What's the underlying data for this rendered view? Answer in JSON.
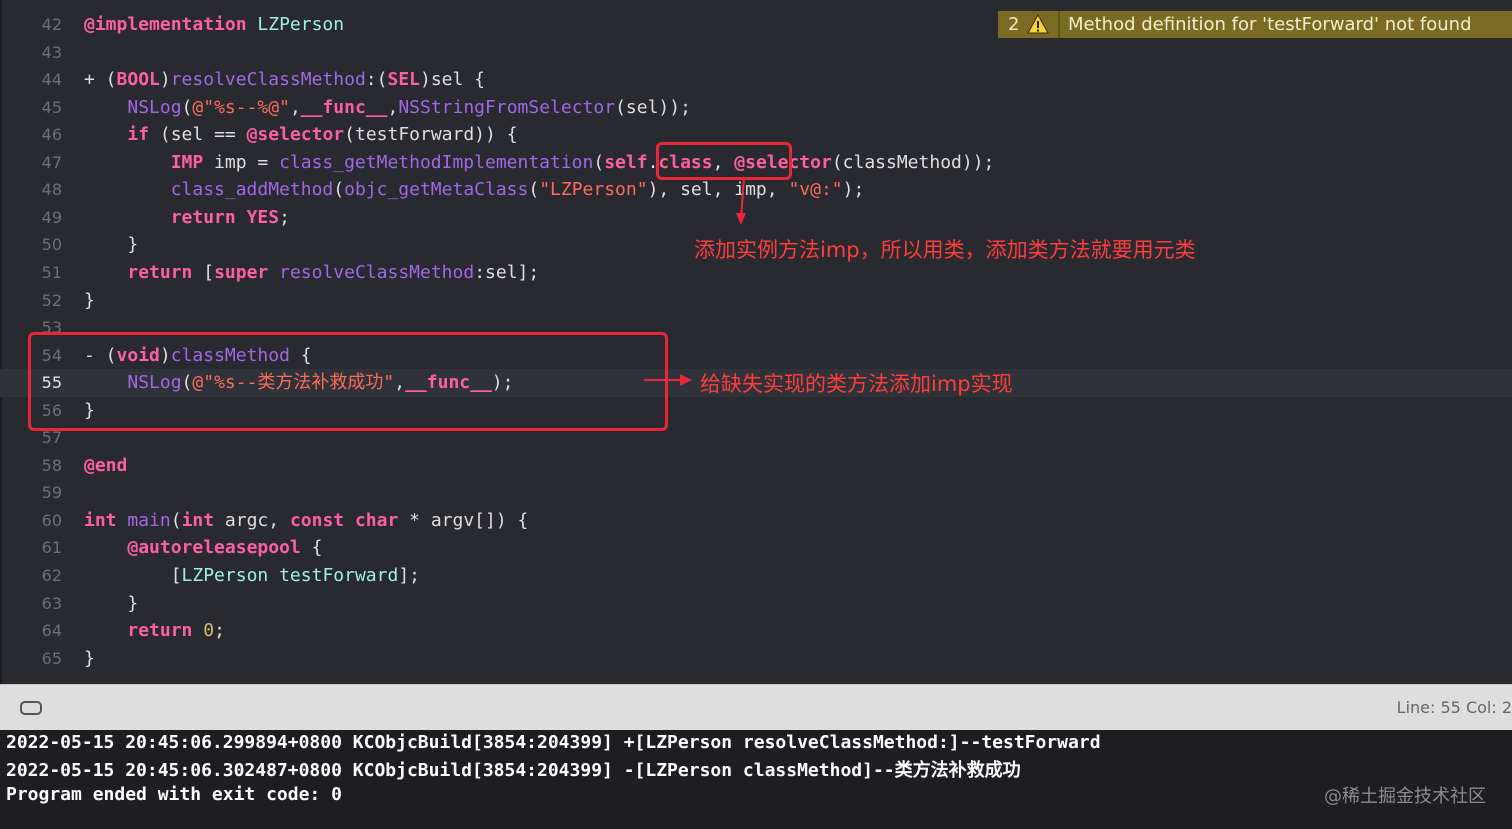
{
  "editor": {
    "lines": [
      {
        "n": "42",
        "s": [
          [
            "kw",
            "@implementation"
          ],
          [
            "pl",
            " "
          ],
          [
            "cls",
            "LZPerson"
          ]
        ]
      },
      {
        "n": "43",
        "s": []
      },
      {
        "n": "44",
        "s": [
          [
            "pl",
            "+ ("
          ],
          [
            "kw",
            "BOOL"
          ],
          [
            "pl",
            ")"
          ],
          [
            "fn",
            "resolveClassMethod"
          ],
          [
            "pl",
            ":("
          ],
          [
            "kw",
            "SEL"
          ],
          [
            "pl",
            ")sel {"
          ]
        ]
      },
      {
        "n": "45",
        "s": [
          [
            "pl",
            "    "
          ],
          [
            "fn",
            "NSLog"
          ],
          [
            "pl",
            "("
          ],
          [
            "str",
            "@\"%s--%@\""
          ],
          [
            "pl",
            ","
          ],
          [
            "kw",
            "__func__"
          ],
          [
            "pl",
            ","
          ],
          [
            "fn",
            "NSStringFromSelector"
          ],
          [
            "pl",
            "(sel));"
          ]
        ]
      },
      {
        "n": "46",
        "s": [
          [
            "pl",
            "    "
          ],
          [
            "kw",
            "if"
          ],
          [
            "pl",
            " (sel == "
          ],
          [
            "kw",
            "@selector"
          ],
          [
            "pl",
            "(testForward)) {"
          ]
        ]
      },
      {
        "n": "47",
        "s": [
          [
            "pl",
            "        "
          ],
          [
            "kw",
            "IMP"
          ],
          [
            "pl",
            " imp = "
          ],
          [
            "fn",
            "class_getMethodImplementation"
          ],
          [
            "pl",
            "("
          ],
          [
            "kw",
            "self"
          ],
          [
            "pl",
            "."
          ],
          [
            "kw",
            "class"
          ],
          [
            "pl",
            ", "
          ],
          [
            "kw",
            "@selector"
          ],
          [
            "pl",
            "(classMethod));"
          ]
        ]
      },
      {
        "n": "48",
        "s": [
          [
            "pl",
            "        "
          ],
          [
            "fn",
            "class_addMethod"
          ],
          [
            "pl",
            "("
          ],
          [
            "fn",
            "objc_getMetaClass"
          ],
          [
            "pl",
            "("
          ],
          [
            "str",
            "\"LZPerson\""
          ],
          [
            "pl",
            "), sel, imp, "
          ],
          [
            "str",
            "\"v@:\""
          ],
          [
            "pl",
            ");"
          ]
        ]
      },
      {
        "n": "49",
        "s": [
          [
            "pl",
            "        "
          ],
          [
            "kw",
            "return"
          ],
          [
            "pl",
            " "
          ],
          [
            "kw",
            "YES"
          ],
          [
            "pl",
            ";"
          ]
        ]
      },
      {
        "n": "50",
        "s": [
          [
            "pl",
            "    }"
          ]
        ]
      },
      {
        "n": "51",
        "s": [
          [
            "pl",
            "    "
          ],
          [
            "kw",
            "return"
          ],
          [
            "pl",
            " ["
          ],
          [
            "kw",
            "super"
          ],
          [
            "pl",
            " "
          ],
          [
            "fn",
            "resolveClassMethod"
          ],
          [
            "pl",
            ":sel];"
          ]
        ]
      },
      {
        "n": "52",
        "s": [
          [
            "pl",
            "}"
          ]
        ]
      },
      {
        "n": "53",
        "s": []
      },
      {
        "n": "54",
        "s": [
          [
            "pl",
            "- ("
          ],
          [
            "kw",
            "void"
          ],
          [
            "pl",
            ")"
          ],
          [
            "fn",
            "classMethod"
          ],
          [
            "pl",
            " {"
          ]
        ]
      },
      {
        "n": "55",
        "s": [
          [
            "pl",
            "    "
          ],
          [
            "fn",
            "NSLog"
          ],
          [
            "pl",
            "("
          ],
          [
            "str",
            "@\"%s--类方法补救成功\""
          ],
          [
            "pl",
            ","
          ],
          [
            "kw",
            "__func__"
          ],
          [
            "pl",
            ");"
          ]
        ]
      },
      {
        "n": "56",
        "s": [
          [
            "pl",
            "}"
          ]
        ]
      },
      {
        "n": "57",
        "s": []
      },
      {
        "n": "58",
        "s": [
          [
            "kw",
            "@end"
          ]
        ]
      },
      {
        "n": "59",
        "s": []
      },
      {
        "n": "60",
        "s": [
          [
            "kw",
            "int"
          ],
          [
            "pl",
            " "
          ],
          [
            "fn",
            "main"
          ],
          [
            "pl",
            "("
          ],
          [
            "kw",
            "int"
          ],
          [
            "pl",
            " argc, "
          ],
          [
            "kw",
            "const"
          ],
          [
            "pl",
            " "
          ],
          [
            "kw",
            "char"
          ],
          [
            "pl",
            " * argv[]) {"
          ]
        ]
      },
      {
        "n": "61",
        "s": [
          [
            "pl",
            "    "
          ],
          [
            "kw",
            "@autoreleasepool"
          ],
          [
            "pl",
            " {"
          ]
        ]
      },
      {
        "n": "62",
        "s": [
          [
            "pl",
            "        ["
          ],
          [
            "cls",
            "LZPerson"
          ],
          [
            "pl",
            " "
          ],
          [
            "cls",
            "testForward"
          ],
          [
            "pl",
            "];"
          ]
        ]
      },
      {
        "n": "63",
        "s": [
          [
            "pl",
            "    }"
          ]
        ]
      },
      {
        "n": "64",
        "s": [
          [
            "pl",
            "    "
          ],
          [
            "kw",
            "return"
          ],
          [
            "pl",
            " "
          ],
          [
            "num",
            "0"
          ],
          [
            "pl",
            ";"
          ]
        ]
      },
      {
        "n": "65",
        "s": [
          [
            "pl",
            "}"
          ]
        ]
      }
    ],
    "current_line": "55"
  },
  "warning": {
    "count": "2",
    "message": "Method definition for 'testForward' not found",
    "color": "#7a6a23"
  },
  "annotations": {
    "note1": "添加实例方法imp，所以用类，添加类方法就要用元类",
    "note2": "给缺失实现的类方法添加imp实现",
    "color": "#e8283a"
  },
  "statusbar": {
    "position": "Line: 55  Col: 2"
  },
  "console": {
    "lines": [
      "2022-05-15 20:45:06.299894+0800 KCObjcBuild[3854:204399] +[LZPerson resolveClassMethod:]--testForward",
      "2022-05-15 20:45:06.302487+0800 KCObjcBuild[3854:204399] -[LZPerson classMethod]--类方法补救成功",
      "Program ended with exit code: 0"
    ]
  },
  "watermark": "@稀土掘金技术社区"
}
